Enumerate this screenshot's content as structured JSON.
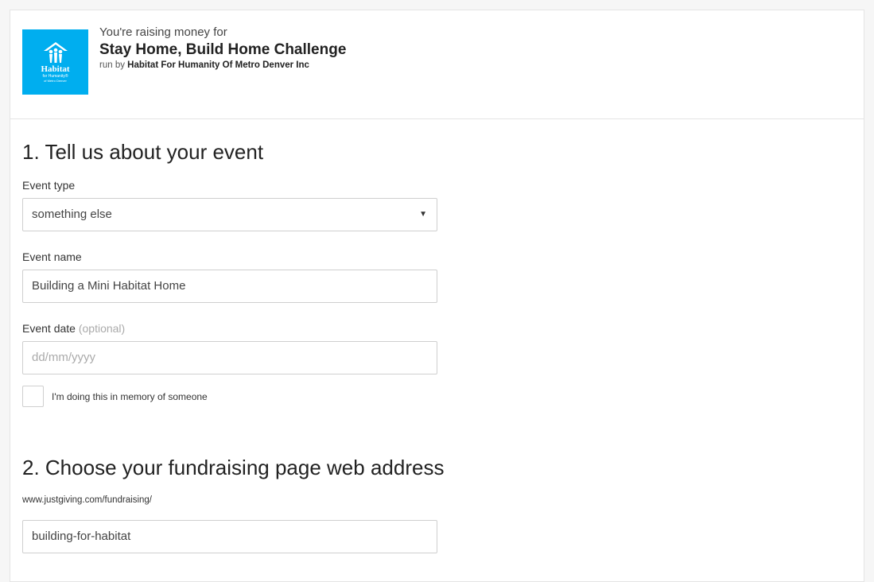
{
  "header": {
    "raising_text": "You're raising money for",
    "campaign_name": "Stay Home, Build Home Challenge",
    "run_by_prefix": "run by",
    "charity_name": "Habitat For Humanity Of Metro Denver Inc",
    "logo": {
      "line1": "Habitat",
      "line2": "for Humanity®",
      "line3": "of Metro Denver",
      "bg_color": "#00aeef"
    }
  },
  "section1": {
    "title": "1. Tell us about your event",
    "event_type_label": "Event type",
    "event_type_value": "something else",
    "event_name_label": "Event name",
    "event_name_value": "Building a Mini Habitat Home",
    "event_date_label": "Event date",
    "event_date_optional": "(optional)",
    "event_date_placeholder": "dd/mm/yyyy",
    "memory_checkbox_label": "I'm doing this in memory of someone"
  },
  "section2": {
    "title": "2. Choose your fundraising page web address",
    "url_prefix": "www.justgiving.com/fundraising/",
    "url_value": "building-for-habitat"
  }
}
